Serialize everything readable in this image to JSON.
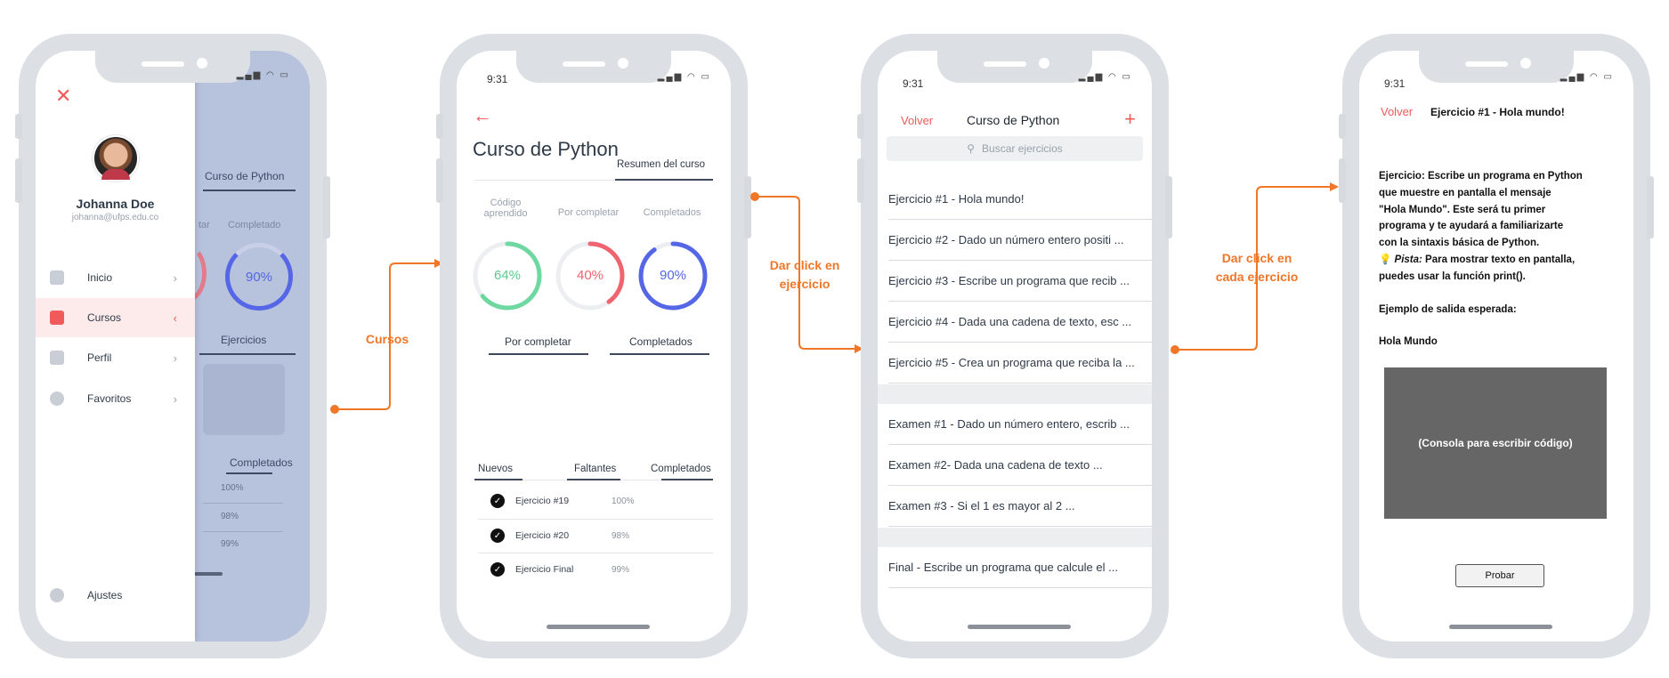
{
  "colors": {
    "accent": "#f05a5a",
    "flow": "#f07628",
    "learned": "#6fd8a0",
    "pending": "#f06470",
    "done": "#5566e6"
  },
  "status_time": "9:31",
  "connectors": {
    "label1": "Cursos",
    "label2": "Dar click en ejercicio",
    "label3": "Dar click en cada ejercicio"
  },
  "phone1": {
    "close_icon": "close-icon",
    "user_name": "Johanna Doe",
    "user_email": "johanna@ufps.edu.co",
    "menu": [
      {
        "label": "Inicio",
        "icon": "home-icon"
      },
      {
        "label": "Cursos",
        "icon": "chart-icon"
      },
      {
        "label": "Perfil",
        "icon": "profile-icon"
      },
      {
        "label": "Favoritos",
        "icon": "heart-icon"
      }
    ],
    "settings_label": "Ajustes",
    "behind": {
      "tab": "Curso de Python",
      "stat_partial": "tar",
      "stat_label": "Completado",
      "stat_value": "90%",
      "section": "Ejercicios",
      "completed_tab": "Completados",
      "rows": [
        "100%",
        "98%",
        "99%"
      ]
    }
  },
  "phone2": {
    "title": "Curso de Python",
    "summary_tab": "Resumen del curso",
    "stats": [
      {
        "label": "Código aprendido",
        "value": "64%",
        "fraction": 0.64
      },
      {
        "label": "Por completar",
        "value": "40%",
        "fraction": 0.4
      },
      {
        "label": "Completados",
        "value": "90%",
        "fraction": 0.9
      }
    ],
    "tabs_a": [
      "Por completar",
      "Completados"
    ],
    "tabs_b": [
      "Nuevos",
      "Faltantes",
      "Completados"
    ],
    "rows": [
      {
        "name": "Ejercicio #19",
        "pct": "100%"
      },
      {
        "name": "Ejercicio #20",
        "pct": "98%"
      },
      {
        "name": "Ejercicio Final",
        "pct": "99%"
      }
    ]
  },
  "phone3": {
    "back": "Volver",
    "title": "Curso de Python",
    "search_placeholder": "Buscar ejercicios",
    "exercises": [
      "Ejercicio #1 - Hola mundo!",
      "Ejercicio #2 - Dado un número entero positi ...",
      "Ejercicio #3 - Escribe un programa que recib ...",
      "Ejercicio #4 - Dada una cadena de texto, esc ...",
      "Ejercicio #5 - Crea un programa que reciba la ..."
    ],
    "exams": [
      "Examen #1 - Dado un número entero, escrib ...",
      "Examen #2- Dada una cadena de texto ...",
      "Examen #3 - Si el 1 es mayor al 2 ..."
    ],
    "final": "Final - Escribe un programa que calcule el ..."
  },
  "phone4": {
    "back": "Volver",
    "title": "Ejercicio #1 - Hola mundo!",
    "lines": [
      "Ejercicio: Escribe un programa en Python",
      "que muestre en pantalla el mensaje",
      "\"Hola Mundo\". Este será tu primer",
      "programa y te ayudará a familiarizarte",
      " con la sintaxis básica de Python."
    ],
    "hint_label": "Pista:",
    "hint_text": " Para mostrar texto en pantalla,",
    "hint_text2": " puedes usar la función print().",
    "example_label": "Ejemplo de salida esperada:",
    "example_output": "Hola Mundo",
    "console_label": "(Consola para escribir código)",
    "run_button": "Probar"
  }
}
